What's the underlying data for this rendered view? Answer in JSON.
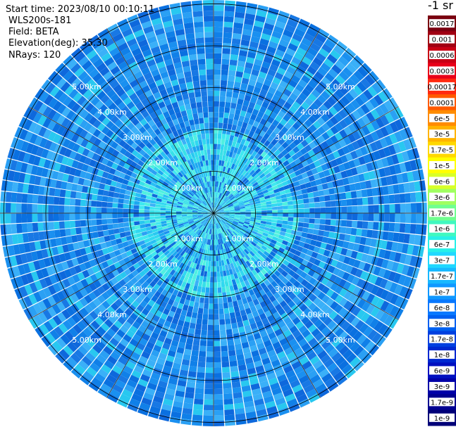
{
  "info": {
    "start_time": "Start time: 2023/08/10 00:10:11",
    "instrument": "WLS200s-181",
    "field": "Field: BETA",
    "elevation": "Elevation(deg): 35.30",
    "nrays": "NRays: 120"
  },
  "colorbar": {
    "unit": "-1 sr",
    "labels": [
      "0.0017",
      "0.001",
      "0.0006",
      "0.0003",
      "0.00017",
      "0.0001",
      "6e-5",
      "3e-5",
      "1.7e-5",
      "1e-5",
      "6e-6",
      "3e-6",
      "1.7e-6",
      "1e-6",
      "6e-7",
      "3e-7",
      "1.7e-7",
      "1e-7",
      "6e-8",
      "3e-8",
      "1.7e-8",
      "1e-8",
      "6e-9",
      "3e-9",
      "1.7e-9",
      "1e-9"
    ],
    "colors": [
      "#7a0010",
      "#a00012",
      "#c80014",
      "#e80018",
      "#ff2a10",
      "#ff5a00",
      "#ff8c00",
      "#ffb400",
      "#ffd800",
      "#ffff00",
      "#d8ff28",
      "#a0ff60",
      "#70ff90",
      "#40f8c0",
      "#28f0e8",
      "#20d8ff",
      "#18b8ff",
      "#1098ff",
      "#0878ff",
      "#0060f0",
      "#0040e0",
      "#0028d0",
      "#0010c0",
      "#0000a8",
      "#000090",
      "#000078"
    ]
  },
  "chart_data": {
    "type": "heatmap",
    "projection": "polar-ppi",
    "field": "BETA",
    "n_rays": 120,
    "range_rings_km": [
      1,
      2,
      3,
      4,
      5
    ],
    "ring_labels": [
      "1.00km",
      "2.00km",
      "3.00km",
      "4.00km",
      "5.00km"
    ],
    "max_range_km": 5.0,
    "spokes_deg": [
      0,
      30,
      60,
      90,
      120,
      150,
      180,
      210,
      240,
      270,
      300,
      330
    ],
    "value_description": "backscatter coefficient, mostly 1e-7 to 3e-7 with near-range ~3e-7 to 6e-7"
  }
}
